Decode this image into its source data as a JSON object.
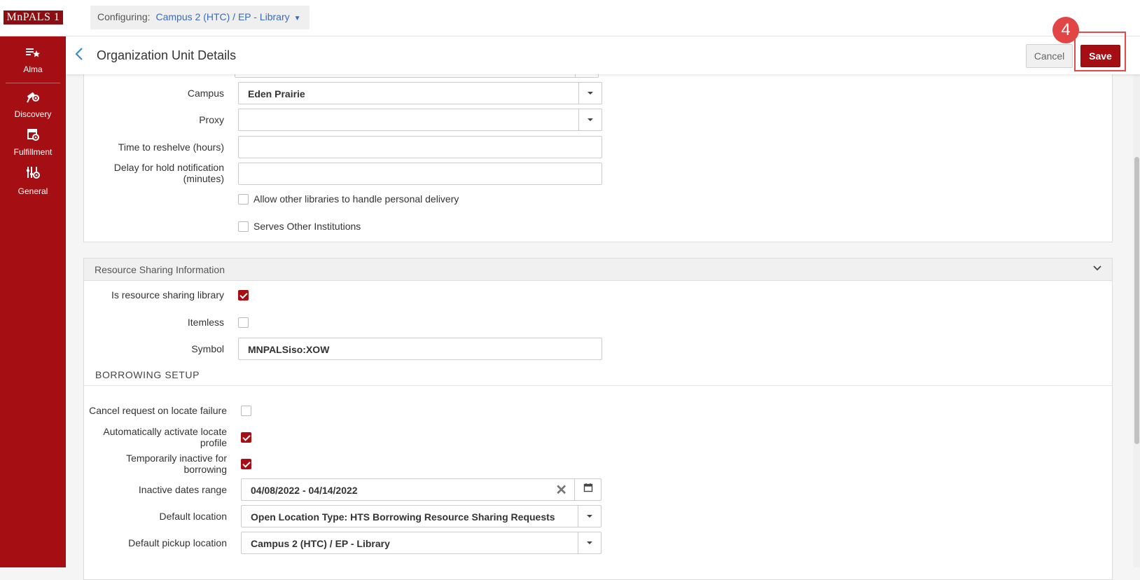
{
  "app": {
    "logo_text": "MnPALS 1",
    "configuring_label": "Configuring:",
    "configuring_value": "Campus 2 (HTC) / EP - Library"
  },
  "sidebar": {
    "items": [
      {
        "label": "Alma",
        "icon": "alma-icon"
      },
      {
        "label": "Discovery",
        "icon": "discovery-icon"
      },
      {
        "label": "Fulfillment",
        "icon": "fulfillment-icon"
      },
      {
        "label": "General",
        "icon": "general-icon"
      }
    ]
  },
  "header": {
    "title": "Organization Unit Details",
    "cancel_label": "Cancel",
    "save_label": "Save",
    "step_number": "4"
  },
  "general_section": {
    "campus_label": "Campus",
    "campus_value": "Eden Prairie",
    "proxy_label": "Proxy",
    "proxy_value": "",
    "reshelve_label": "Time to reshelve (hours)",
    "reshelve_value": "",
    "hold_delay_label_1": "Delay for hold notification",
    "hold_delay_label_2": "(minutes)",
    "hold_delay_value": "",
    "personal_delivery_label": "Allow other libraries to handle personal delivery",
    "personal_delivery_checked": false,
    "serves_other_label": "Serves Other Institutions",
    "serves_other_checked": false
  },
  "resource_sharing": {
    "section_title": "Resource Sharing Information",
    "is_rs_library_label": "Is resource sharing library",
    "is_rs_library_checked": true,
    "itemless_label": "Itemless",
    "itemless_checked": false,
    "symbol_label": "Symbol",
    "symbol_value": "MNPALSiso:XOW",
    "borrowing_setup_title": "BORROWING SETUP",
    "cancel_locate_label": "Cancel request on locate failure",
    "cancel_locate_checked": false,
    "auto_activate_label_1": "Automatically activate locate",
    "auto_activate_label_2": "profile",
    "auto_activate_checked": true,
    "temp_inactive_label_1": "Temporarily inactive for",
    "temp_inactive_label_2": "borrowing",
    "temp_inactive_checked": true,
    "inactive_dates_label": "Inactive dates range",
    "inactive_dates_value": "04/08/2022 - 04/14/2022",
    "default_location_label": "Default location",
    "default_location_value": "Open Location Type: HTS Borrowing Resource Sharing Requests",
    "default_pickup_label": "Default pickup location",
    "default_pickup_value": "Campus 2 (HTC) / EP - Library"
  }
}
